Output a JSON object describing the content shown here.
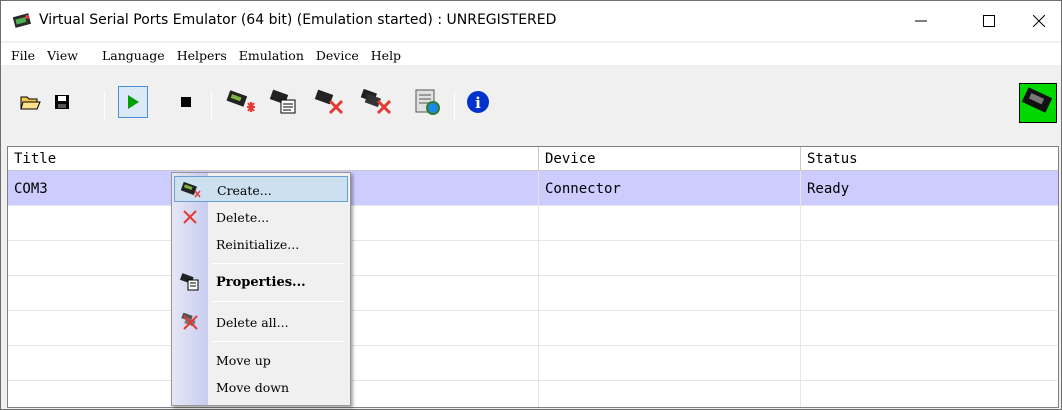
{
  "window": {
    "title": "Virtual Serial Ports Emulator (64 bit) (Emulation started) : UNREGISTERED"
  },
  "menubar": {
    "items": [
      "File",
      "View",
      "Language",
      "Helpers",
      "Emulation",
      "Device",
      "Help"
    ]
  },
  "toolbar": {
    "buttons": [
      "open-icon",
      "save-icon",
      "start-emulation-icon",
      "stop-emulation-icon",
      "create-device-icon",
      "properties-icon",
      "delete-device-icon",
      "delete-all-icon",
      "data-logger-icon",
      "info-icon"
    ],
    "pressed": "start-emulation-icon"
  },
  "list": {
    "columns": [
      "Title",
      "Device",
      "Status"
    ],
    "rows": [
      {
        "title": "COM3",
        "device": "Connector",
        "status": "Ready",
        "selected": true
      }
    ]
  },
  "context_menu": {
    "items": [
      {
        "label": "Create...",
        "icon": "create-device-icon",
        "highlighted": true
      },
      {
        "label": "Delete...",
        "icon": "delete-icon"
      },
      {
        "label": "Reinitialize..."
      },
      {
        "label": "Properties...",
        "icon": "properties-icon",
        "bold": true
      },
      {
        "label": "Delete all...",
        "icon": "delete-all-icon"
      },
      {
        "label": "Move up"
      },
      {
        "label": "Move down"
      }
    ]
  },
  "colors": {
    "selection": "#ccccff",
    "accent_green": "#00d800",
    "menu_highlight": "#cde0f0"
  }
}
